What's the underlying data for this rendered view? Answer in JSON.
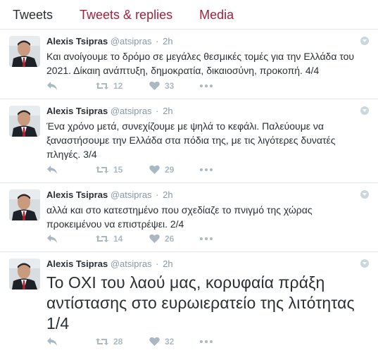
{
  "tabs": [
    {
      "label": "Tweets"
    },
    {
      "label": "Tweets & replies"
    },
    {
      "label": "Media"
    }
  ],
  "colors": {
    "accent": "#a5213a",
    "muted": "#8899a6",
    "icon": "#aab8c2",
    "divider": "#e1e8ed"
  },
  "tweets": [
    {
      "name": "Alexis Tsipras",
      "handle": "@atsipras",
      "separator": "·",
      "time": "2h",
      "text": "Και ανοίγουμε το δρόμο σε μεγάλες θεσμικές τομές για την Ελλάδα του 2021. Δίκαιη ανάπτυξη, δημοκρατία, δικαιοσύνη, προκοπή. 4/4",
      "retweets": "12",
      "likes": "33"
    },
    {
      "name": "Alexis Tsipras",
      "handle": "@atsipras",
      "separator": "·",
      "time": "2h",
      "text": "Ένα χρόνο μετά, συνεχίζουμε με ψηλά το κεφάλι. Παλεύουμε να ξαναστήσουμε την Ελλάδα στα πόδια της, με τις λιγότερες δυνατές πληγές. 3/4",
      "retweets": "15",
      "likes": "29"
    },
    {
      "name": "Alexis Tsipras",
      "handle": "@atsipras",
      "separator": "·",
      "time": "2h",
      "text": "αλλά και στο κατεστημένο που σχεδίαζε το πνιγμό της χώρας προκειμένου να επιστρέψει. 2/4",
      "retweets": "14",
      "likes": "26"
    },
    {
      "name": "Alexis Tsipras",
      "handle": "@atsipras",
      "separator": "·",
      "time": "2h",
      "text": "Το ΟΧΙ του λαού μας, κορυφαία πράξη αντίστασης στο ευρωιερατείο της λιτότητας 1/4",
      "retweets": "28",
      "likes": "32"
    }
  ]
}
